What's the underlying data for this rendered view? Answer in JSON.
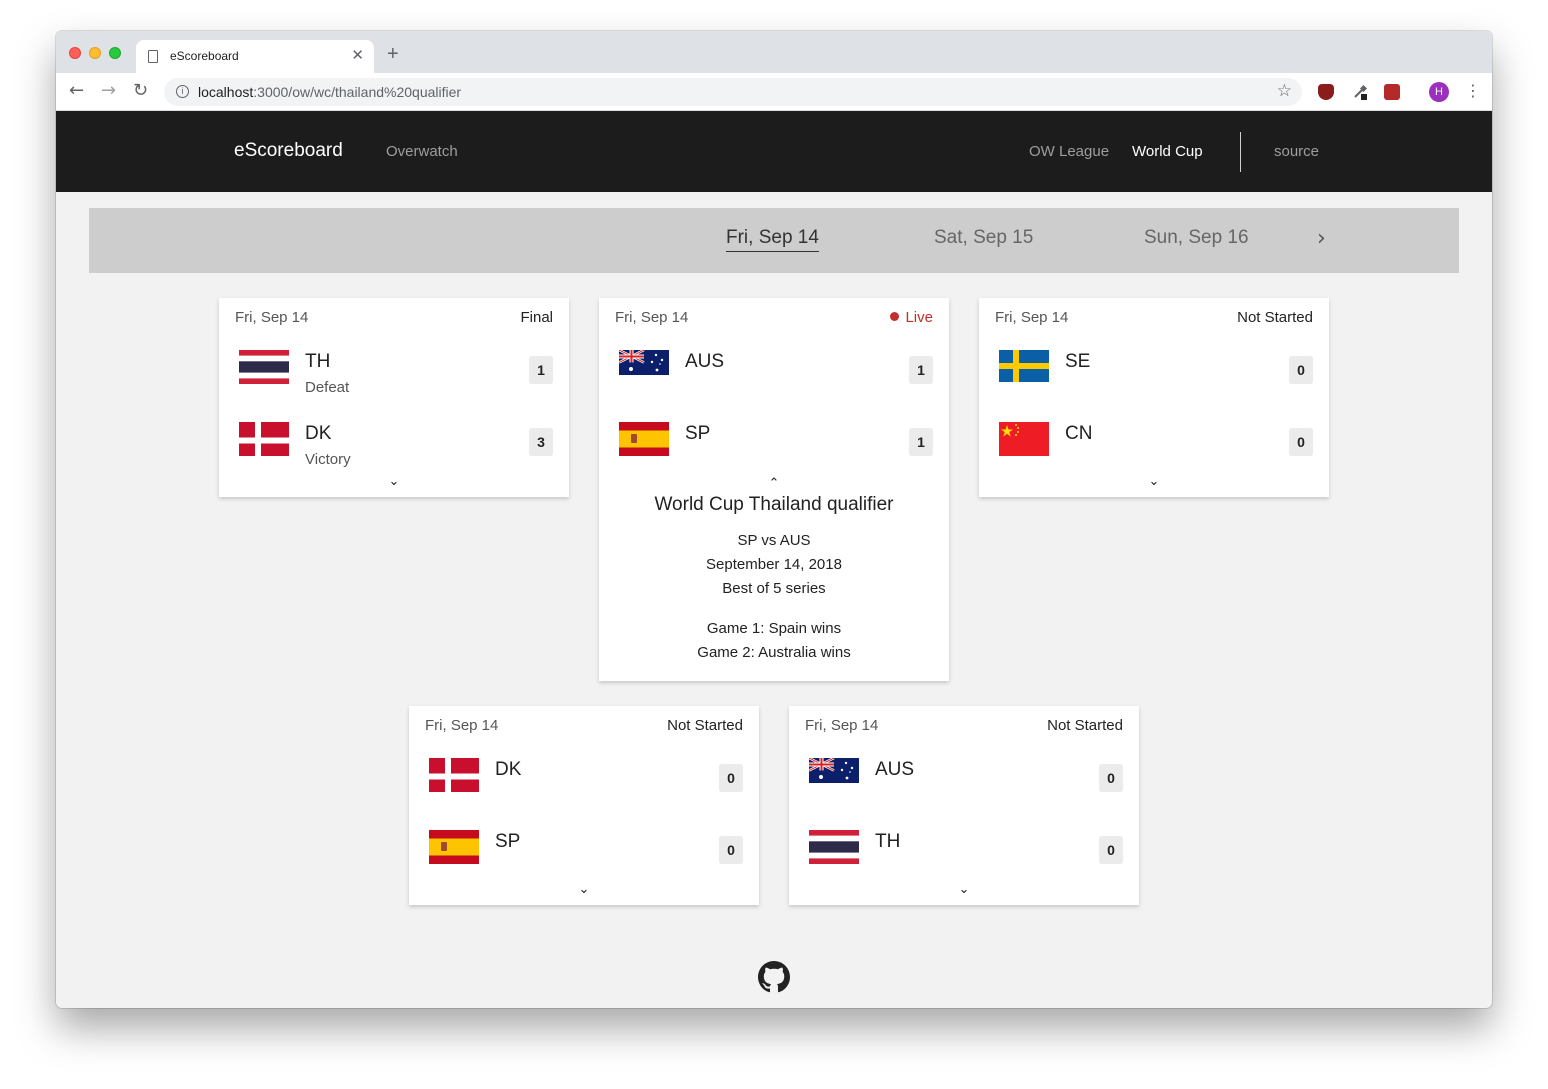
{
  "browser": {
    "tab_title": "eScoreboard",
    "url_host": "localhost",
    "url_rest": ":3000/ow/wc/thailand%20qualifier",
    "avatar_letter": "H"
  },
  "navbar": {
    "brand": "eScoreboard",
    "game": "Overwatch",
    "links": [
      "OW League",
      "World Cup",
      "source"
    ],
    "active_link": "World Cup"
  },
  "dates": {
    "items": [
      "Fri, Sep 14",
      "Sat, Sep 15",
      "Sun, Sep 16"
    ],
    "active": "Fri, Sep 14",
    "next_icon": "chevron-right-icon"
  },
  "matches": [
    {
      "date": "Fri, Sep 14",
      "status": "Final",
      "teams": [
        {
          "code": "TH",
          "flag": "thailand",
          "result": "Defeat",
          "score": "1"
        },
        {
          "code": "DK",
          "flag": "denmark",
          "result": "Victory",
          "score": "3"
        }
      ]
    },
    {
      "date": "Fri, Sep 14",
      "status": "Live",
      "teams": [
        {
          "code": "AUS",
          "flag": "australia",
          "result": "",
          "score": "1"
        },
        {
          "code": "SP",
          "flag": "spain",
          "result": "",
          "score": "1"
        }
      ],
      "details": {
        "title": "World Cup Thailand qualifier",
        "matchup": "SP vs AUS",
        "date_full": "September 14, 2018",
        "format": "Best of 5 series",
        "games": [
          "Game 1: Spain wins",
          "Game 2: Australia wins"
        ]
      }
    },
    {
      "date": "Fri, Sep 14",
      "status": "Not Started",
      "teams": [
        {
          "code": "SE",
          "flag": "sweden",
          "result": "",
          "score": "0"
        },
        {
          "code": "CN",
          "flag": "china",
          "result": "",
          "score": "0"
        }
      ]
    },
    {
      "date": "Fri, Sep 14",
      "status": "Not Started",
      "teams": [
        {
          "code": "DK",
          "flag": "denmark",
          "result": "",
          "score": "0"
        },
        {
          "code": "SP",
          "flag": "spain",
          "result": "",
          "score": "0"
        }
      ]
    },
    {
      "date": "Fri, Sep 14",
      "status": "Not Started",
      "teams": [
        {
          "code": "AUS",
          "flag": "australia",
          "result": "",
          "score": "0"
        },
        {
          "code": "TH",
          "flag": "thailand",
          "result": "",
          "score": "0"
        }
      ]
    }
  ],
  "colors": {
    "navbar_bg": "#1b1c1b",
    "datebar_bg": "#cdcdcd",
    "page_bg": "#f2f2f2",
    "live": "#c42d2d"
  },
  "footer": {
    "icon": "github-icon"
  }
}
